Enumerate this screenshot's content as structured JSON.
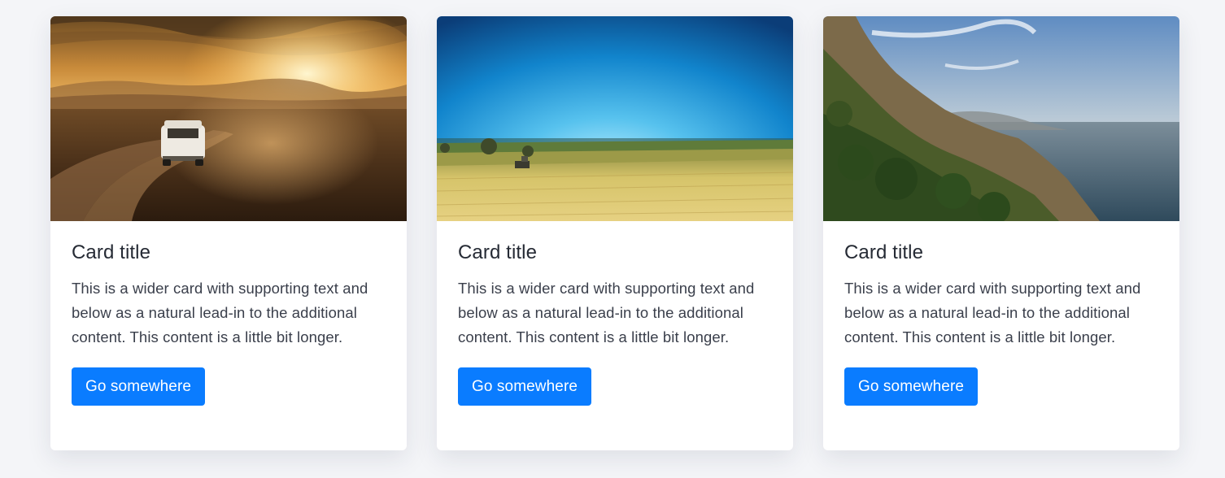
{
  "colors": {
    "page_background": "#f4f5f8",
    "card_background": "#ffffff",
    "button": "#0a7cff",
    "button_text": "#ffffff",
    "title_text": "#252a34",
    "body_text": "#3a3f4b"
  },
  "cards": [
    {
      "image": "photo-van-on-desert-road-at-sunset",
      "title": "Card title",
      "text": "This is a wider card with supporting text and below as a natural lead-in to the additional content. This content is a little bit longer.",
      "button_label": "Go somewhere"
    },
    {
      "image": "photo-wheat-field-under-blue-sky",
      "title": "Card title",
      "text": "This is a wider card with supporting text and below as a natural lead-in to the additional content. This content is a little bit longer.",
      "button_label": "Go somewhere"
    },
    {
      "image": "photo-coastal-cliffs-and-sea",
      "title": "Card title",
      "text": "This is a wider card with supporting text and below as a natural lead-in to the additional content. This content is a little bit longer.",
      "button_label": "Go somewhere"
    }
  ]
}
